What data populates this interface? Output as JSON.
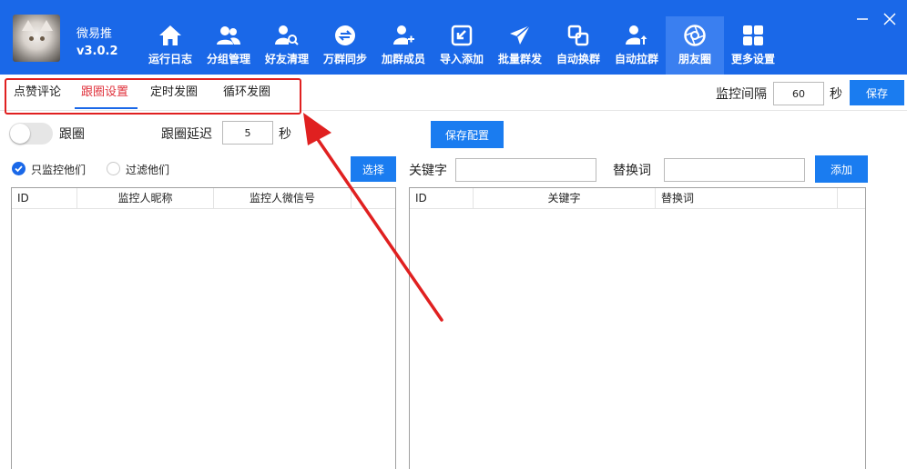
{
  "app": {
    "name": "微易推",
    "version": "v3.0.2"
  },
  "nav": [
    {
      "label": "运行日志",
      "icon": "home-icon"
    },
    {
      "label": "分组管理",
      "icon": "users-icon"
    },
    {
      "label": "好友清理",
      "icon": "user-search-icon"
    },
    {
      "label": "万群同步",
      "icon": "sync-icon"
    },
    {
      "label": "加群成员",
      "icon": "user-add-icon"
    },
    {
      "label": "导入添加",
      "icon": "import-icon"
    },
    {
      "label": "批量群发",
      "icon": "send-icon"
    },
    {
      "label": "自动换群",
      "icon": "swap-icon"
    },
    {
      "label": "自动拉群",
      "icon": "user-up-icon"
    },
    {
      "label": "朋友圈",
      "icon": "aperture-icon",
      "active": true
    },
    {
      "label": "更多设置",
      "icon": "grid-icon"
    }
  ],
  "tabs": [
    {
      "label": "点赞评论"
    },
    {
      "label": "跟圈设置",
      "active": true
    },
    {
      "label": "定时发圈"
    },
    {
      "label": "循环发圈"
    }
  ],
  "monitor": {
    "label": "监控间隔",
    "value": "60",
    "unit": "秒",
    "save": "保存"
  },
  "follow": {
    "toggle_label": "跟圈",
    "toggle_on": false,
    "delay_label": "跟圈延迟",
    "delay_value": "5",
    "delay_unit": "秒",
    "save_config": "保存配置"
  },
  "filter": {
    "only_monitor": "只监控他们",
    "exclude": "过滤他们",
    "selected": "only_monitor",
    "select_button": "选择"
  },
  "keyword": {
    "keyword_label": "关键字",
    "keyword_value": "",
    "replace_label": "替换词",
    "replace_value": "",
    "add_button": "添加"
  },
  "left_table": {
    "columns": [
      "ID",
      "监控人昵称",
      "监控人微信号"
    ],
    "rows": []
  },
  "right_table": {
    "columns": [
      "ID",
      "关键字",
      "替换词"
    ],
    "rows": []
  },
  "colors": {
    "header": "#1a68e8",
    "button": "#1a7cf0",
    "active_tab_text": "#e0333d",
    "annotation": "#e02020"
  }
}
